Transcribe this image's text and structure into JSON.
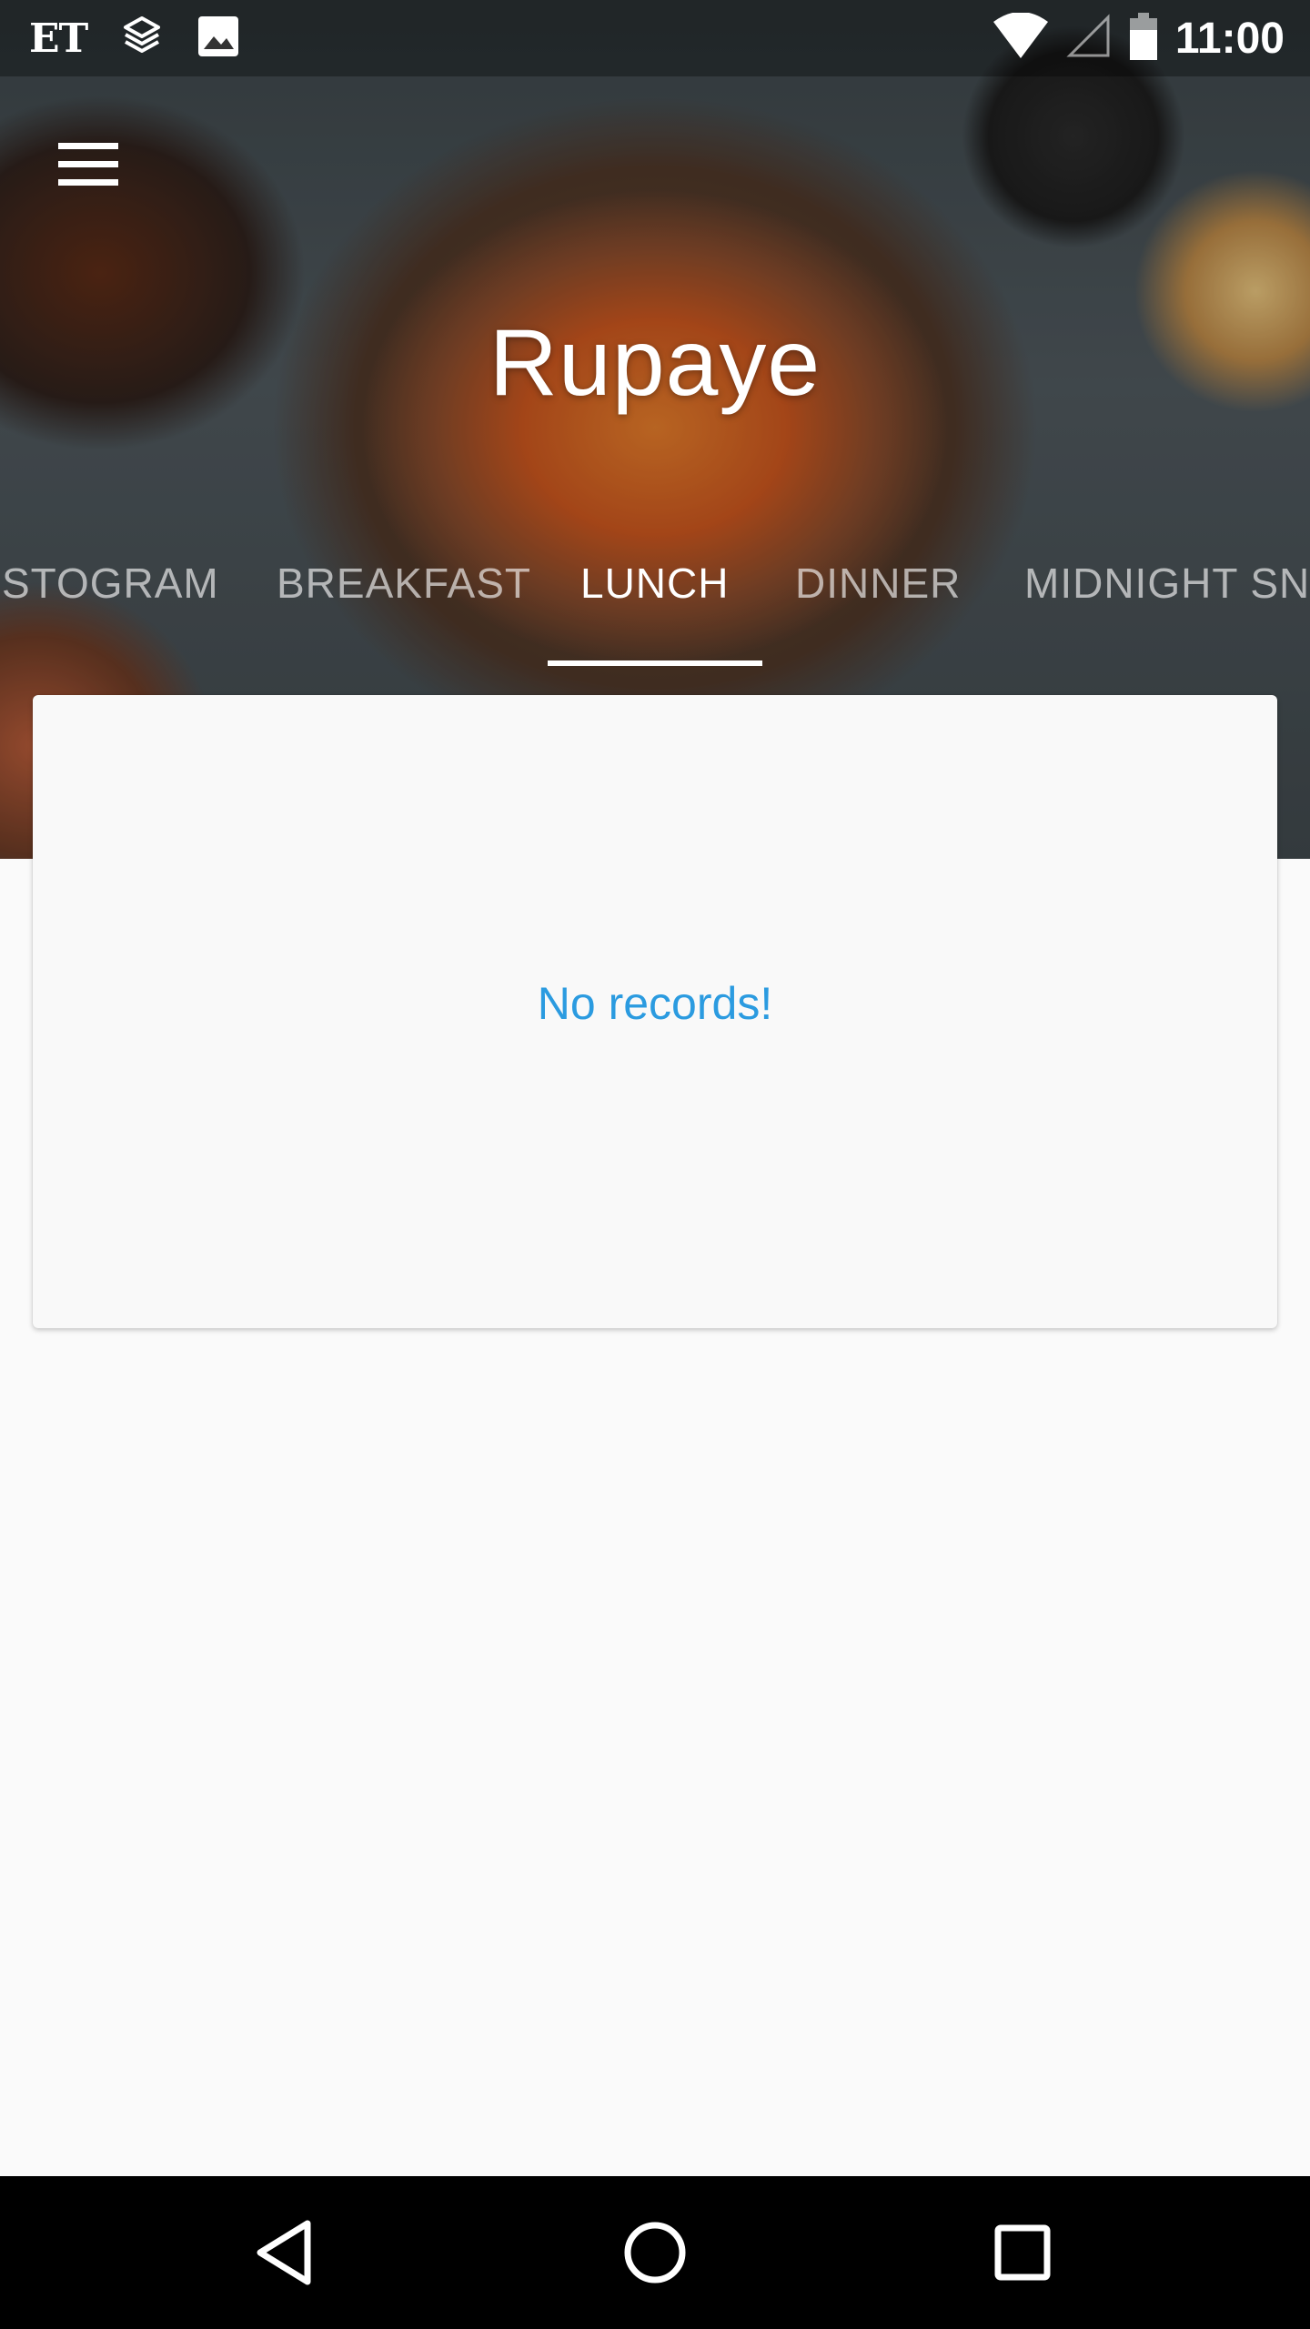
{
  "status_bar": {
    "left_icons": [
      "et-app-icon",
      "layers-app-icon",
      "image-icon"
    ],
    "et_label": "ET",
    "right_icons": [
      "wifi-icon",
      "cell-signal-icon",
      "battery-icon"
    ],
    "time": "11:00"
  },
  "header": {
    "title": "Rupaye",
    "menu_icon": "hamburger-menu-icon"
  },
  "tabs": {
    "items": [
      {
        "label": "STOGRAM"
      },
      {
        "label": "BREAKFAST"
      },
      {
        "label": "LUNCH",
        "active": true
      },
      {
        "label": "DINNER"
      },
      {
        "label": "MIDNIGHT SN"
      }
    ],
    "active_index": 2
  },
  "content": {
    "empty_message": "No records!"
  },
  "nav_bar": {
    "buttons": [
      "back-icon",
      "home-icon",
      "recents-icon"
    ]
  },
  "colors": {
    "empty_message": "#2b9be0",
    "background": "#fafafa",
    "nav_bar": "#000000"
  }
}
